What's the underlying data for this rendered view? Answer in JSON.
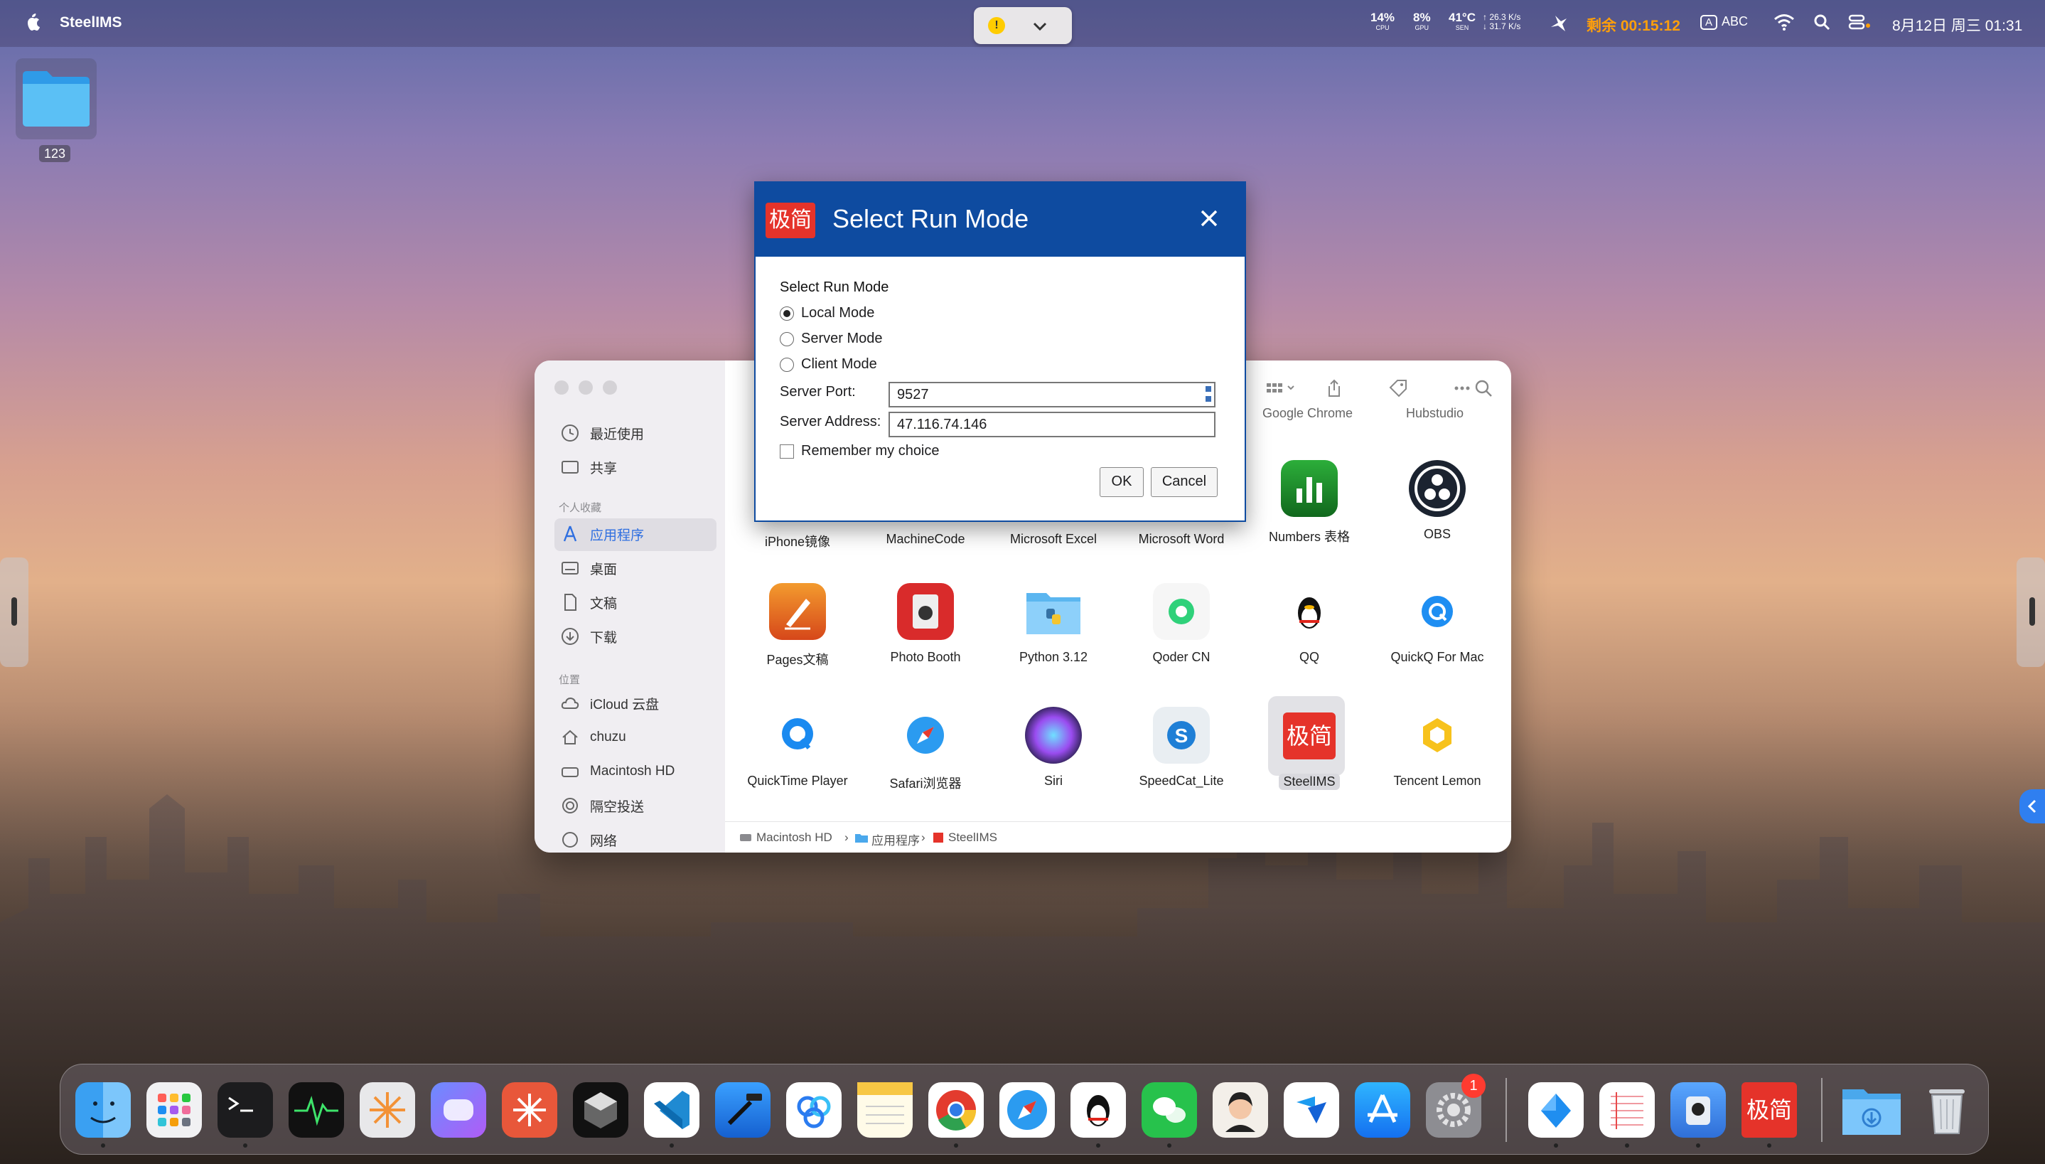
{
  "colors": {
    "accent": "#0e4ba0",
    "timer": "#ff9f0a",
    "logo_red": "#e5332a"
  },
  "menubar": {
    "app_name": "SteelIMS",
    "cpu": {
      "value": "14%",
      "label": "CPU"
    },
    "gpu": {
      "value": "8%",
      "label": "GPU"
    },
    "sen": {
      "value": "41°C",
      "label": "SEN"
    },
    "net_up": "↑ 26.3 K/s",
    "net_down": "↓ 31.7 K/s",
    "timer": "剩余 00:15:12",
    "ime_letter": "A",
    "ime_label": "ABC",
    "clock": "8月12日 周三  01:31"
  },
  "desktop": {
    "folder_label": "123"
  },
  "finder": {
    "sidebar": {
      "items_top": [
        "最近使用",
        "共享"
      ],
      "favorites_header": "个人收藏",
      "favorites": [
        "应用程序",
        "桌面",
        "文稿",
        "下载"
      ],
      "locations_header": "位置",
      "locations": [
        "iCloud 云盘",
        "chuzu",
        "Macintosh HD",
        "隔空投送",
        "网络"
      ]
    },
    "toolbar_labels": [
      "Google Chrome",
      "Hubstudio"
    ],
    "row1": [
      "iPhone镜像",
      "MachineCode",
      "Microsoft Excel",
      "Microsoft Word",
      "Numbers 表格",
      "OBS"
    ],
    "row2": [
      "Pages文稿",
      "Photo Booth",
      "Python 3.12",
      "Qoder CN",
      "QQ",
      "QuickQ For Mac"
    ],
    "row3": [
      "QuickTime Player",
      "Safari浏览器",
      "Siri",
      "SpeedCat_Lite",
      "SteelIMS",
      "Tencent Lemon"
    ],
    "path": [
      "Macintosh HD",
      "应用程序",
      "SteelIMS"
    ]
  },
  "dialog": {
    "logo_text": "极简",
    "title": "Select Run Mode",
    "group_label": "Select Run Mode",
    "modes": [
      {
        "label": "Local Mode",
        "selected": true
      },
      {
        "label": "Server Mode",
        "selected": false
      },
      {
        "label": "Client Mode",
        "selected": false
      }
    ],
    "server_port_label": "Server Port:",
    "server_port_value": "9527",
    "server_address_label": "Server Address:",
    "server_address_value": "47.116.74.146",
    "remember_label": "Remember my choice",
    "ok_label": "OK",
    "cancel_label": "Cancel"
  },
  "dock": {
    "badge_count": "1",
    "steel_logo_text": "极简",
    "icons": [
      "finder-icon",
      "launchpad-icon",
      "terminal-icon",
      "activity-monitor-icon",
      "perplexity-icon",
      "copilot-icon",
      "claude-icon",
      "cursor-icon",
      "vscode-icon",
      "xcode-icon",
      "baidu-netdisk-icon",
      "notes-icon",
      "chrome-icon",
      "safari-icon",
      "qq-icon",
      "wechat-icon",
      "avatar-app-icon",
      "lark-icon",
      "app-store-icon",
      "system-settings-icon",
      "feishu-icon",
      "textedit-icon",
      "preview-icon",
      "steelims-icon",
      "downloads-folder-icon",
      "trash-icon"
    ]
  }
}
